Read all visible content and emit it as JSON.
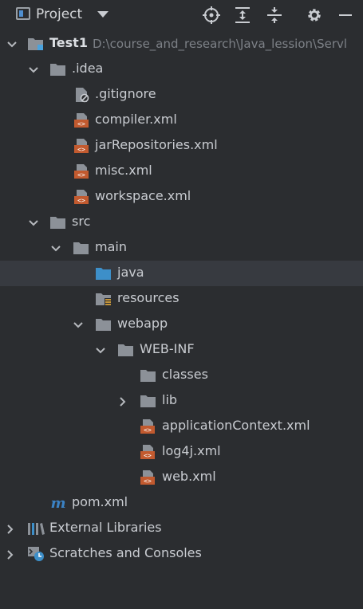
{
  "toolbar": {
    "title": "Project",
    "icons": [
      "locate-icon",
      "expand-all-icon",
      "collapse-all-icon",
      "gear-icon",
      "minimize-icon"
    ]
  },
  "tree": {
    "root": {
      "name": "Test1",
      "path": "D:\\course_and_research\\Java_lession\\Servl"
    },
    "idea": ".idea",
    "gitignore": ".gitignore",
    "compiler": "compiler.xml",
    "jarRepositories": "jarRepositories.xml",
    "misc": "misc.xml",
    "workspace": "workspace.xml",
    "src": "src",
    "main": "main",
    "java": "java",
    "resources": "resources",
    "webapp": "webapp",
    "webinf": "WEB-INF",
    "classes": "classes",
    "lib": "lib",
    "appctx": "applicationContext.xml",
    "log4j": "log4j.xml",
    "webxml": "web.xml",
    "pom": "pom.xml",
    "external": "External Libraries",
    "scratches": "Scratches and Consoles"
  },
  "colors": {
    "folder": "#8c9198",
    "folder_source": "#3d8fc9",
    "xml_badge": "#c25a2f",
    "maven": "#3b82c4",
    "background": "#2b2d30",
    "selection": "#373a40"
  }
}
